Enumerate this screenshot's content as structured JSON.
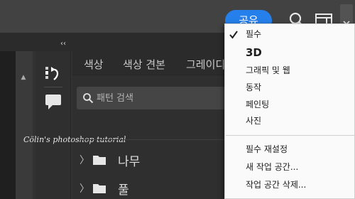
{
  "topbar": {
    "share_label": "공유",
    "search_icon": "search-icon",
    "panels_icon": "panel-layout-icon",
    "workspace_icon": "chevron-down-icon"
  },
  "collapse_label": "‹‹",
  "tools": {
    "history_icon": "history-icon",
    "comment_icon": "comment-icon"
  },
  "panel": {
    "tabs": [
      {
        "label": "색상"
      },
      {
        "label": "색상 견본"
      },
      {
        "label": "그레이디"
      }
    ],
    "search": {
      "placeholder": "패턴 검색",
      "value": ""
    },
    "folders": [
      {
        "label": "나무"
      },
      {
        "label": "풀"
      }
    ]
  },
  "watermark": "Cölin's photoshop tutorial",
  "menu": {
    "items": [
      {
        "label": "필수",
        "checked": true
      },
      {
        "label": "3D"
      },
      {
        "label": "그래픽 및 웹"
      },
      {
        "label": "동작"
      },
      {
        "label": "페인팅"
      },
      {
        "label": "사진"
      },
      {
        "label": "필수 재설정"
      },
      {
        "label": "새 작업 공간..."
      },
      {
        "label": "작업 공간 삭제..."
      }
    ]
  },
  "colors": {
    "accent": "#2680eb",
    "background": "#323232",
    "menu_bg": "#fafafa"
  }
}
